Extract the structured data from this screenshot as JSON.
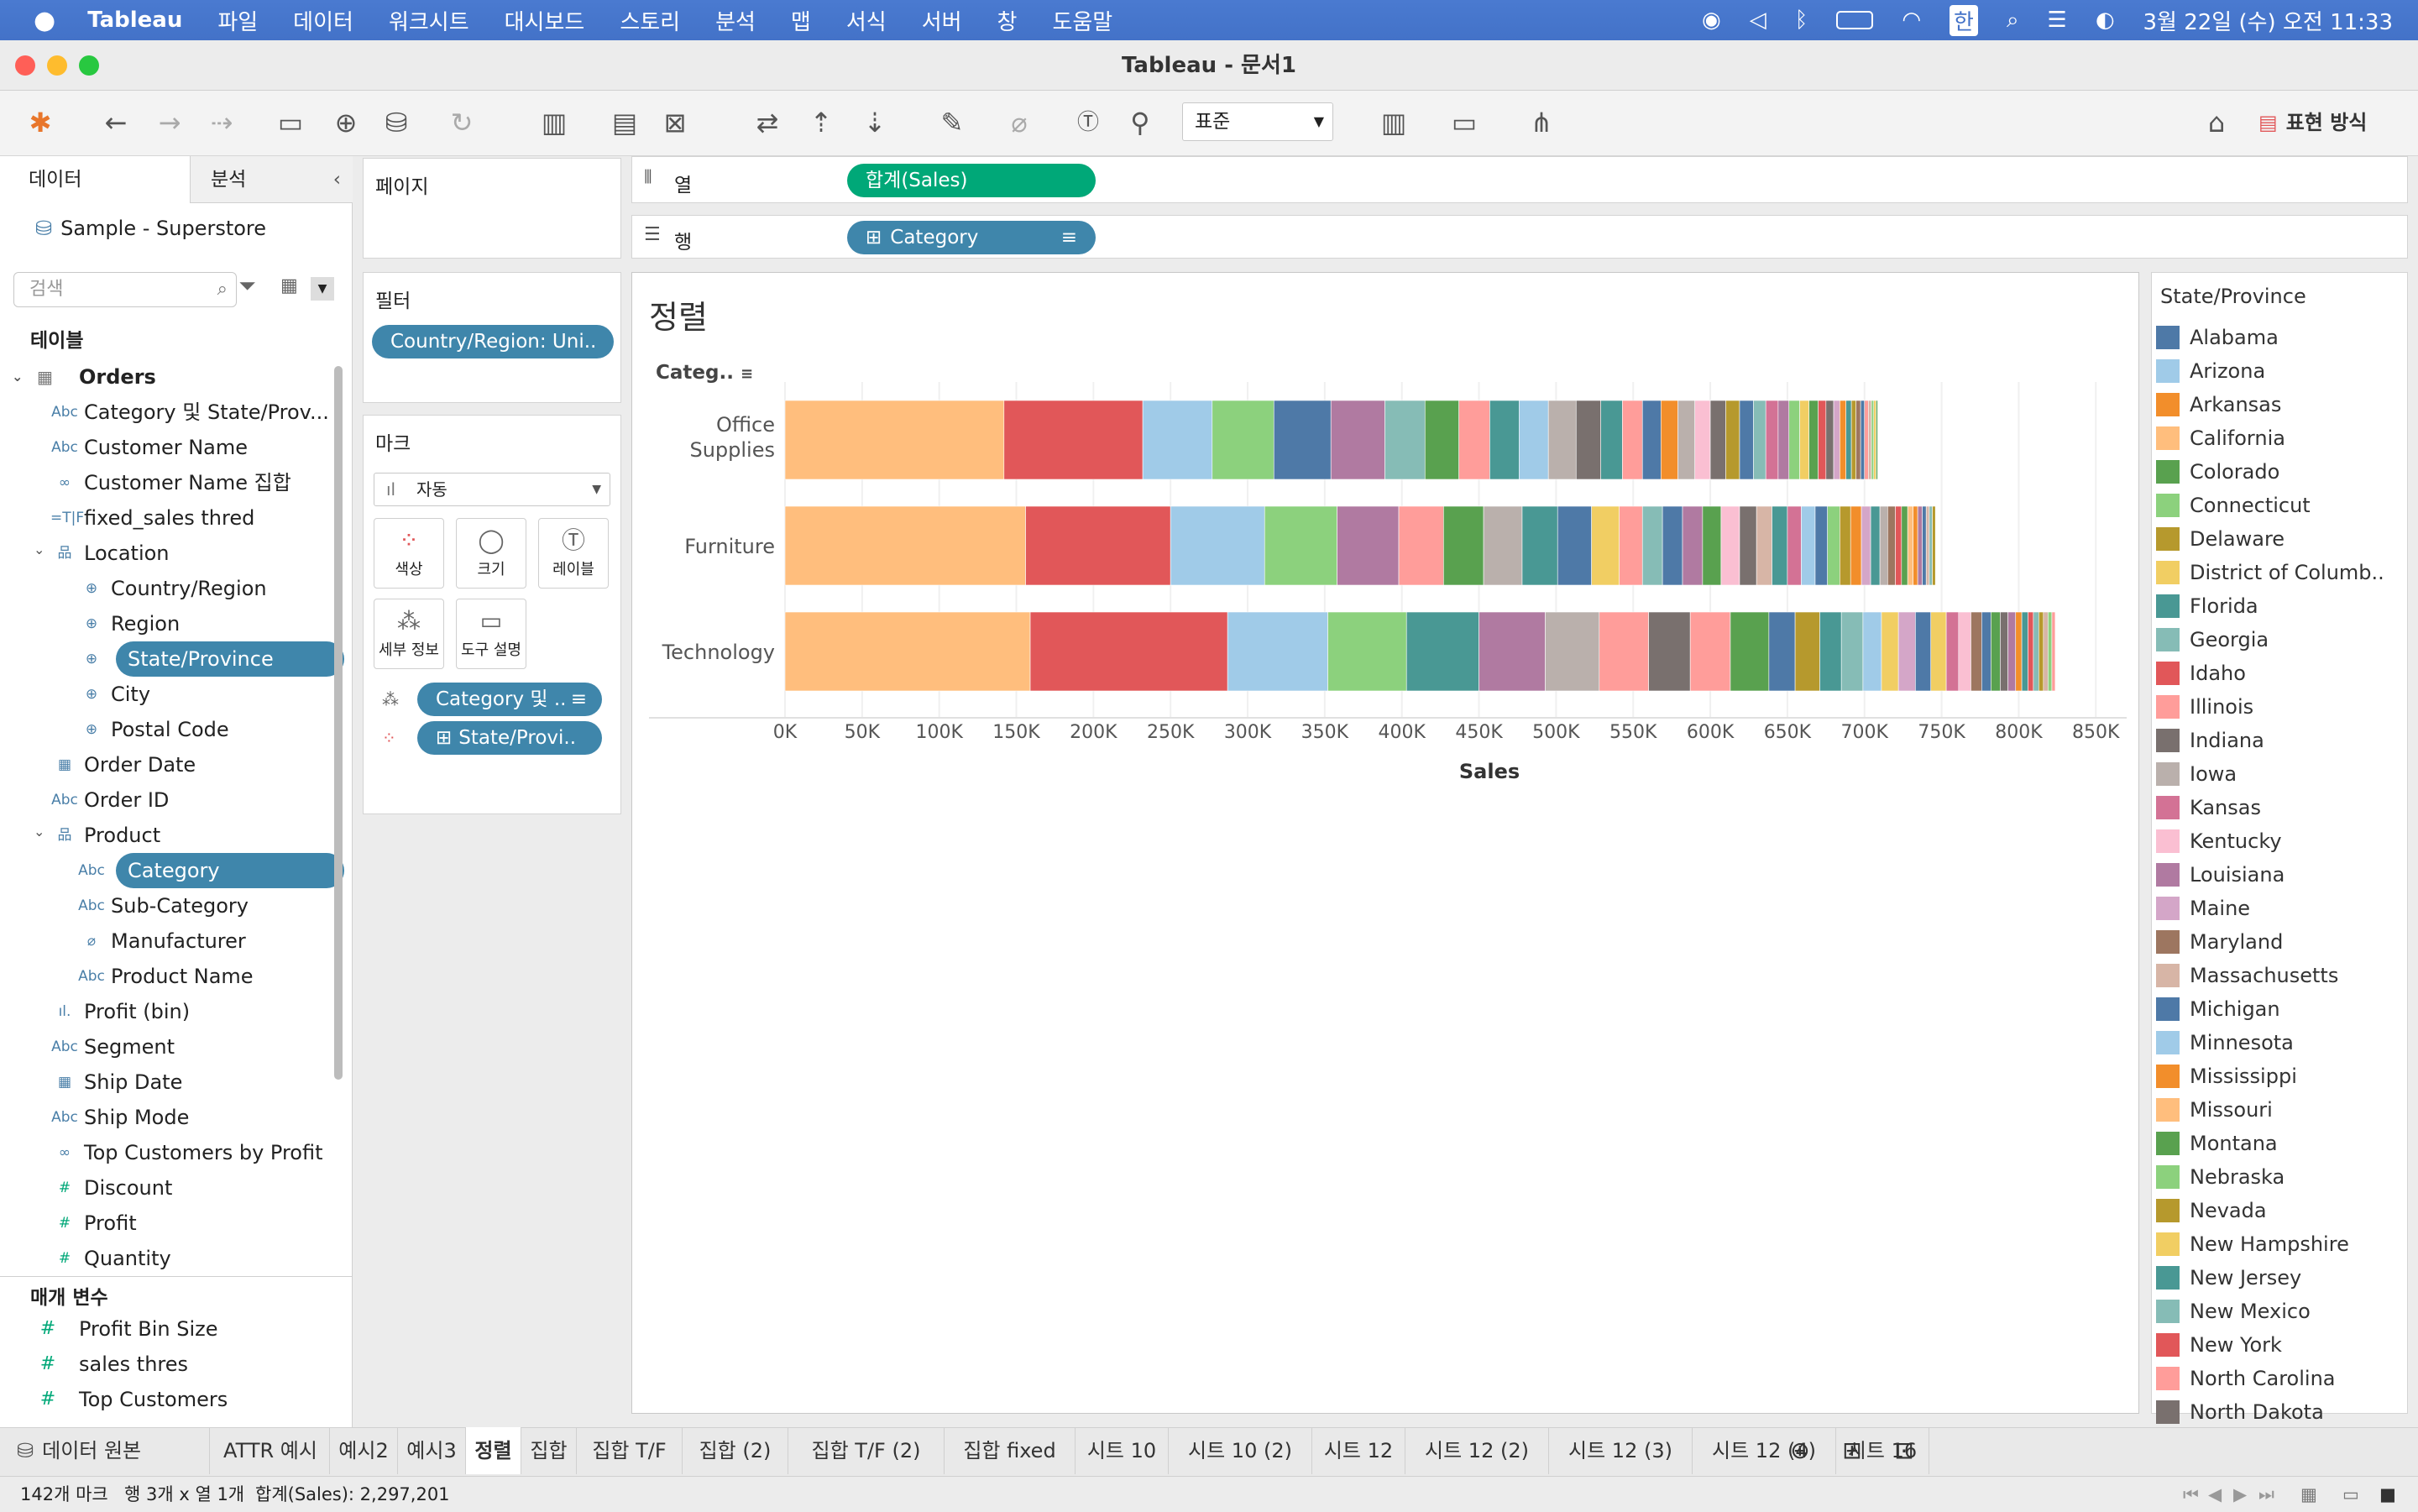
{
  "menubar": {
    "app_name": "Tableau",
    "items": [
      "파일",
      "데이터",
      "워크시트",
      "대시보드",
      "스토리",
      "분석",
      "맵",
      "서식",
      "서버",
      "창",
      "도움말"
    ],
    "clock": "3월 22일 (수) 오전 11:33",
    "input_method": "한"
  },
  "window": {
    "title": "Tableau - 문서1"
  },
  "toolbar": {
    "fit_select": "표준",
    "show_me": "표현 방식"
  },
  "data_pane": {
    "tab_data": "데이터",
    "tab_analysis": "분석",
    "datasource": "Sample - Superstore",
    "search_placeholder": "검색",
    "tables_header": "테이블",
    "table_name": "Orders",
    "fields": [
      {
        "icon": "Abc",
        "label": "Category 및 State/Prov...",
        "indent": 1
      },
      {
        "icon": "Abc",
        "label": "Customer Name",
        "indent": 1
      },
      {
        "icon": "∞",
        "label": "Customer Name 집합",
        "indent": 1
      },
      {
        "icon": "=T|F",
        "label": "fixed_sales thred",
        "indent": 1
      },
      {
        "icon": "品",
        "label": "Location",
        "indent": 1,
        "folder": true
      },
      {
        "icon": "⊕",
        "label": "Country/Region",
        "indent": 2
      },
      {
        "icon": "⊕",
        "label": "Region",
        "indent": 2
      },
      {
        "icon": "⊕",
        "label": "State/Province",
        "indent": 2,
        "selected": true
      },
      {
        "icon": "⊕",
        "label": "City",
        "indent": 2
      },
      {
        "icon": "⊕",
        "label": "Postal Code",
        "indent": 2
      },
      {
        "icon": "▦",
        "label": "Order Date",
        "indent": 1
      },
      {
        "icon": "Abc",
        "label": "Order ID",
        "indent": 1
      },
      {
        "icon": "品",
        "label": "Product",
        "indent": 1,
        "folder": true
      },
      {
        "icon": "Abc",
        "label": "Category",
        "indent": 2,
        "selected": true
      },
      {
        "icon": "Abc",
        "label": "Sub-Category",
        "indent": 2
      },
      {
        "icon": "⌀",
        "label": "Manufacturer",
        "indent": 2
      },
      {
        "icon": "Abc",
        "label": "Product Name",
        "indent": 2
      },
      {
        "icon": "ıl.",
        "label": "Profit (bin)",
        "indent": 1
      },
      {
        "icon": "Abc",
        "label": "Segment",
        "indent": 1
      },
      {
        "icon": "▦",
        "label": "Ship Date",
        "indent": 1
      },
      {
        "icon": "Abc",
        "label": "Ship Mode",
        "indent": 1
      },
      {
        "icon": "∞",
        "label": "Top Customers by Profit",
        "indent": 1
      },
      {
        "icon": "#",
        "label": "Discount",
        "indent": 1,
        "measure": true
      },
      {
        "icon": "#",
        "label": "Profit",
        "indent": 1,
        "measure": true
      },
      {
        "icon": "#",
        "label": "Quantity",
        "indent": 1,
        "measure": true
      }
    ],
    "params_header": "매개 변수",
    "params": [
      "Profit Bin Size",
      "sales thres",
      "Top Customers"
    ]
  },
  "shelves": {
    "pages": "페이지",
    "filters": "필터",
    "filter_pill": "Country/Region: Uni..",
    "marks": "마크",
    "mark_type": "자동",
    "mark_cards": [
      "색상",
      "크기",
      "레이블",
      "세부 정보",
      "도구 설명"
    ],
    "mark_pill_1": "Category 및 ..",
    "mark_pill_2": "State/Provi..",
    "columns_label": "열",
    "columns_pill": "합계(Sales)",
    "rows_label": "행",
    "rows_pill": "Category"
  },
  "view": {
    "sheet_title": "정렬",
    "row_header": "Categ.."
  },
  "chart_data": {
    "type": "bar",
    "orientation": "horizontal",
    "stacked": true,
    "categories": [
      "Office Supplies",
      "Furniture",
      "Technology"
    ],
    "totals": [
      719047,
      741999,
      836154
    ],
    "xlabel": "Sales",
    "xlim": [
      0,
      870000
    ],
    "x_ticks": [
      "0K",
      "50K",
      "100K",
      "150K",
      "200K",
      "250K",
      "300K",
      "350K",
      "400K",
      "450K",
      "500K",
      "550K",
      "600K",
      "650K",
      "700K",
      "750K",
      "800K",
      "850K"
    ],
    "stack_by": "State/Province",
    "segments": [
      [
        [
          142000,
          "#ffbe7d"
        ],
        [
          90000,
          "#e15759"
        ],
        [
          45000,
          "#a0cbe8"
        ],
        [
          40000,
          "#8cd17d"
        ],
        [
          37000,
          "#4e79a7"
        ],
        [
          35000,
          "#b07aa1"
        ],
        [
          26000,
          "#86bcb6"
        ],
        [
          22000,
          "#59a14f"
        ],
        [
          20000,
          "#ff9d9a"
        ],
        [
          19000,
          "#499894"
        ],
        [
          19000,
          "#a0cbe8"
        ],
        [
          18000,
          "#bab0ac"
        ],
        [
          16000,
          "#79706e"
        ],
        [
          14000,
          "#499894"
        ],
        [
          13000,
          "#ff9d9a"
        ],
        [
          12000,
          "#4e79a7"
        ],
        [
          11000,
          "#f28e2b"
        ],
        [
          11000,
          "#bab0ac"
        ],
        [
          10000,
          "#fabfd2"
        ],
        [
          10000,
          "#79706e"
        ],
        [
          9000,
          "#b6992d"
        ],
        [
          9000,
          "#4e79a7"
        ],
        [
          8000,
          "#86bcb6"
        ],
        [
          8000,
          "#d37295"
        ],
        [
          7000,
          "#b07aa1"
        ],
        [
          7000,
          "#8cd17d"
        ],
        [
          6000,
          "#f1ce63"
        ],
        [
          6000,
          "#59a14f"
        ],
        [
          5000,
          "#e15759"
        ],
        [
          5000,
          "#79706e"
        ],
        [
          4000,
          "#d4a6c8"
        ],
        [
          4000,
          "#f28e2b"
        ],
        [
          3500,
          "#499894"
        ],
        [
          3000,
          "#b6992d"
        ],
        [
          3000,
          "#9d7660"
        ],
        [
          2500,
          "#4e79a7"
        ],
        [
          2500,
          "#ff9d9a"
        ],
        [
          2000,
          "#d7b5a6"
        ],
        [
          1500,
          "#8cd17d"
        ],
        [
          1500,
          "#f1ce63"
        ],
        [
          1047,
          "#59a14f"
        ]
      ],
      [
        [
          156000,
          "#ffbe7d"
        ],
        [
          94000,
          "#e15759"
        ],
        [
          61000,
          "#a0cbe8"
        ],
        [
          47000,
          "#8cd17d"
        ],
        [
          40000,
          "#b07aa1"
        ],
        [
          29000,
          "#ff9d9a"
        ],
        [
          26000,
          "#59a14f"
        ],
        [
          25000,
          "#bab0ac"
        ],
        [
          23000,
          "#499894"
        ],
        [
          22000,
          "#4e79a7"
        ],
        [
          18000,
          "#f1ce63"
        ],
        [
          15000,
          "#ff9d9a"
        ],
        [
          13000,
          "#86bcb6"
        ],
        [
          13000,
          "#4e79a7"
        ],
        [
          13000,
          "#b07aa1"
        ],
        [
          12000,
          "#59a14f"
        ],
        [
          12000,
          "#fabfd2"
        ],
        [
          11000,
          "#79706e"
        ],
        [
          10000,
          "#d7b5a6"
        ],
        [
          10000,
          "#499894"
        ],
        [
          9000,
          "#d37295"
        ],
        [
          9000,
          "#a0cbe8"
        ],
        [
          8000,
          "#4e79a7"
        ],
        [
          8000,
          "#8cd17d"
        ],
        [
          7000,
          "#b6992d"
        ],
        [
          7000,
          "#f28e2b"
        ],
        [
          6000,
          "#d4a6c8"
        ],
        [
          6000,
          "#499894"
        ],
        [
          5000,
          "#bab0ac"
        ],
        [
          5000,
          "#9d7660"
        ],
        [
          4000,
          "#e15759"
        ],
        [
          4000,
          "#59a14f"
        ],
        [
          3500,
          "#ffbe7d"
        ],
        [
          3000,
          "#f28e2b"
        ],
        [
          3000,
          "#b07aa1"
        ],
        [
          2500,
          "#4e79a7"
        ],
        [
          2000,
          "#d7b5a6"
        ],
        [
          2000,
          "#86bcb6"
        ],
        [
          1999,
          "#b6992d"
        ]
      ],
      [
        [
          159000,
          "#ffbe7d"
        ],
        [
          128000,
          "#e15759"
        ],
        [
          65000,
          "#a0cbe8"
        ],
        [
          51000,
          "#8cd17d"
        ],
        [
          47000,
          "#499894"
        ],
        [
          43000,
          "#b07aa1"
        ],
        [
          35000,
          "#bab0ac"
        ],
        [
          32000,
          "#ff9d9a"
        ],
        [
          27000,
          "#79706e"
        ],
        [
          26000,
          "#ff9d9a"
        ],
        [
          25000,
          "#59a14f"
        ],
        [
          17000,
          "#4e79a7"
        ],
        [
          16000,
          "#b6992d"
        ],
        [
          14000,
          "#499894"
        ],
        [
          14000,
          "#86bcb6"
        ],
        [
          12000,
          "#a0cbe8"
        ],
        [
          11000,
          "#f1ce63"
        ],
        [
          11000,
          "#d4a6c8"
        ],
        [
          10000,
          "#4e79a7"
        ],
        [
          10000,
          "#f1ce63"
        ],
        [
          8000,
          "#d37295"
        ],
        [
          8000,
          "#fabfd2"
        ],
        [
          7000,
          "#9d7660"
        ],
        [
          6000,
          "#4e79a7"
        ],
        [
          6000,
          "#59a14f"
        ],
        [
          5000,
          "#79706e"
        ],
        [
          5000,
          "#b07aa1"
        ],
        [
          4000,
          "#f28e2b"
        ],
        [
          4000,
          "#499894"
        ],
        [
          3500,
          "#e15759"
        ],
        [
          3500,
          "#86bcb6"
        ],
        [
          3000,
          "#b6992d"
        ],
        [
          3000,
          "#d7b5a6"
        ],
        [
          2500,
          "#8cd17d"
        ],
        [
          2154,
          "#ff9d9a"
        ]
      ]
    ]
  },
  "legend": {
    "title": "State/Province",
    "items": [
      {
        "name": "Alabama",
        "color": "#4e79a7"
      },
      {
        "name": "Arizona",
        "color": "#a0cbe8"
      },
      {
        "name": "Arkansas",
        "color": "#f28e2b"
      },
      {
        "name": "California",
        "color": "#ffbe7d"
      },
      {
        "name": "Colorado",
        "color": "#59a14f"
      },
      {
        "name": "Connecticut",
        "color": "#8cd17d"
      },
      {
        "name": "Delaware",
        "color": "#b6992d"
      },
      {
        "name": "District of Columb..",
        "color": "#f1ce63"
      },
      {
        "name": "Florida",
        "color": "#499894"
      },
      {
        "name": "Georgia",
        "color": "#86bcb6"
      },
      {
        "name": "Idaho",
        "color": "#e15759"
      },
      {
        "name": "Illinois",
        "color": "#ff9d9a"
      },
      {
        "name": "Indiana",
        "color": "#79706e"
      },
      {
        "name": "Iowa",
        "color": "#bab0ac"
      },
      {
        "name": "Kansas",
        "color": "#d37295"
      },
      {
        "name": "Kentucky",
        "color": "#fabfd2"
      },
      {
        "name": "Louisiana",
        "color": "#b07aa1"
      },
      {
        "name": "Maine",
        "color": "#d4a6c8"
      },
      {
        "name": "Maryland",
        "color": "#9d7660"
      },
      {
        "name": "Massachusetts",
        "color": "#d7b5a6"
      },
      {
        "name": "Michigan",
        "color": "#4e79a7"
      },
      {
        "name": "Minnesota",
        "color": "#a0cbe8"
      },
      {
        "name": "Mississippi",
        "color": "#f28e2b"
      },
      {
        "name": "Missouri",
        "color": "#ffbe7d"
      },
      {
        "name": "Montana",
        "color": "#59a14f"
      },
      {
        "name": "Nebraska",
        "color": "#8cd17d"
      },
      {
        "name": "Nevada",
        "color": "#b6992d"
      },
      {
        "name": "New Hampshire",
        "color": "#f1ce63"
      },
      {
        "name": "New Jersey",
        "color": "#499894"
      },
      {
        "name": "New Mexico",
        "color": "#86bcb6"
      },
      {
        "name": "New York",
        "color": "#e15759"
      },
      {
        "name": "North Carolina",
        "color": "#ff9d9a"
      },
      {
        "name": "North Dakota",
        "color": "#79706e"
      }
    ]
  },
  "sheet_tabs": {
    "datasource_tab": "데이터 원본",
    "tabs": [
      "ATTR 예시",
      "예시2",
      "예시3",
      "정렬",
      "집합",
      "집합 T/F",
      "집합 (2)",
      "집합 T/F (2)",
      "집합 fixed",
      "시트 10",
      "시트 10 (2)",
      "시트 12",
      "시트 12 (2)",
      "시트 12 (3)",
      "시트 12 (4)",
      "시트 16"
    ],
    "active": "정렬"
  },
  "status": {
    "marks": "142개 마크",
    "rows_cols": "행 3개 x 열 1개",
    "sum": "합계(Sales): 2,297,201"
  }
}
